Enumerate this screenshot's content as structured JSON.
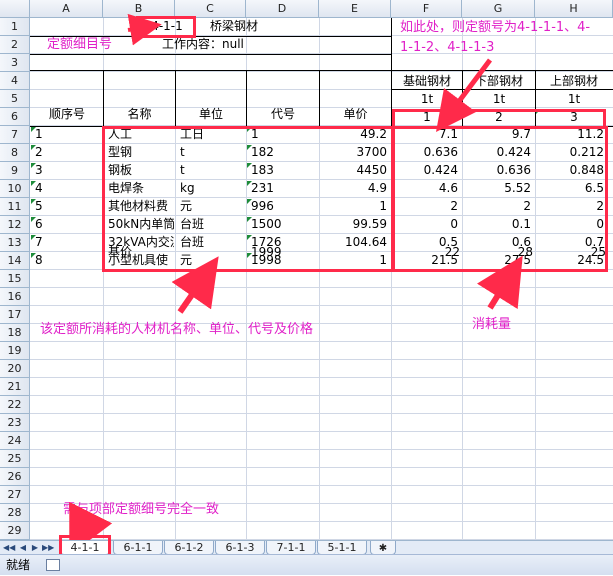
{
  "spreadsheet": {
    "columns": [
      "A",
      "B",
      "C",
      "D",
      "E",
      "F",
      "G",
      "H"
    ],
    "rows": [
      "1",
      "2",
      "3",
      "4",
      "5",
      "6",
      "7",
      "8",
      "9",
      "10",
      "11",
      "12",
      "13",
      "14",
      "15",
      "16",
      "17",
      "18",
      "19",
      "20",
      "21",
      "22",
      "23",
      "24",
      "25",
      "26",
      "27",
      "28",
      "29"
    ],
    "header": {
      "quota_code": "4-1-1",
      "title": "桥梁钢材",
      "quota_detail_label": "定额细目号",
      "work_content": "工作内容：null"
    },
    "col_titles": {
      "seq": "顺序号",
      "name": "名称",
      "unit": "单位",
      "code": "代号",
      "price": "单价"
    },
    "material_groups": [
      {
        "name": "基础钢材",
        "unit": "1t",
        "index": "1"
      },
      {
        "name": "下部钢材",
        "unit": "1t",
        "index": "2"
      },
      {
        "name": "上部钢材",
        "unit": "1t",
        "index": "3"
      }
    ],
    "items": [
      {
        "seq": "1",
        "name": "人工",
        "unit": "工日",
        "code": "1",
        "price": "49.2",
        "f": "7.1",
        "g": "9.7",
        "h": "11.2"
      },
      {
        "seq": "2",
        "name": "型钢",
        "unit": "t",
        "code": "182",
        "price": "3700",
        "f": "0.636",
        "g": "0.424",
        "h": "0.212"
      },
      {
        "seq": "3",
        "name": "钢板",
        "unit": "t",
        "code": "183",
        "price": "4450",
        "f": "0.424",
        "g": "0.636",
        "h": "0.848"
      },
      {
        "seq": "4",
        "name": "电焊条",
        "unit": "kg",
        "code": "231",
        "price": "4.9",
        "f": "4.6",
        "g": "5.52",
        "h": "6.5"
      },
      {
        "seq": "5",
        "name": "其他材料费",
        "unit": "元",
        "code": "996",
        "price": "1",
        "f": "2",
        "g": "2",
        "h": "2"
      },
      {
        "seq": "6",
        "name": "50kN内单筒",
        "unit": "台班",
        "code": "1500",
        "price": "99.59",
        "f": "0",
        "g": "0.1",
        "h": "0"
      },
      {
        "seq": "7",
        "name": "32kVA内交流",
        "unit": "台班",
        "code": "1726",
        "price": "104.64",
        "f": "0.5",
        "g": "0.6",
        "h": "0.7"
      },
      {
        "seq": "8",
        "name": "小型机具使",
        "unit": "元",
        "code": "1998",
        "price": "1",
        "f": "21.5",
        "g": "27.5",
        "h": "24.5"
      }
    ],
    "base_row": {
      "name": "基价",
      "code": "1999",
      "f": "22",
      "g": "28",
      "h": "25"
    }
  },
  "annotations": {
    "top_right_line1": "如此处，则定额号为4-1-1-1、4-",
    "top_right_line2": "1-1-2、4-1-1-3",
    "middle_left": "该定额所消耗的人材机名称、单位、代号及价格",
    "middle_right": "消耗量",
    "bottom": "需与项部定额细号完全一致"
  },
  "tabs": [
    "4-1-1",
    "6-1-1",
    "6-1-2",
    "6-1-3",
    "7-1-1",
    "5-1-1"
  ],
  "active_tab": "4-1-1",
  "status": {
    "ready": "就绪"
  },
  "colors": {
    "annotation": "#e020c8",
    "highlight_box": "#ff2a4a"
  }
}
